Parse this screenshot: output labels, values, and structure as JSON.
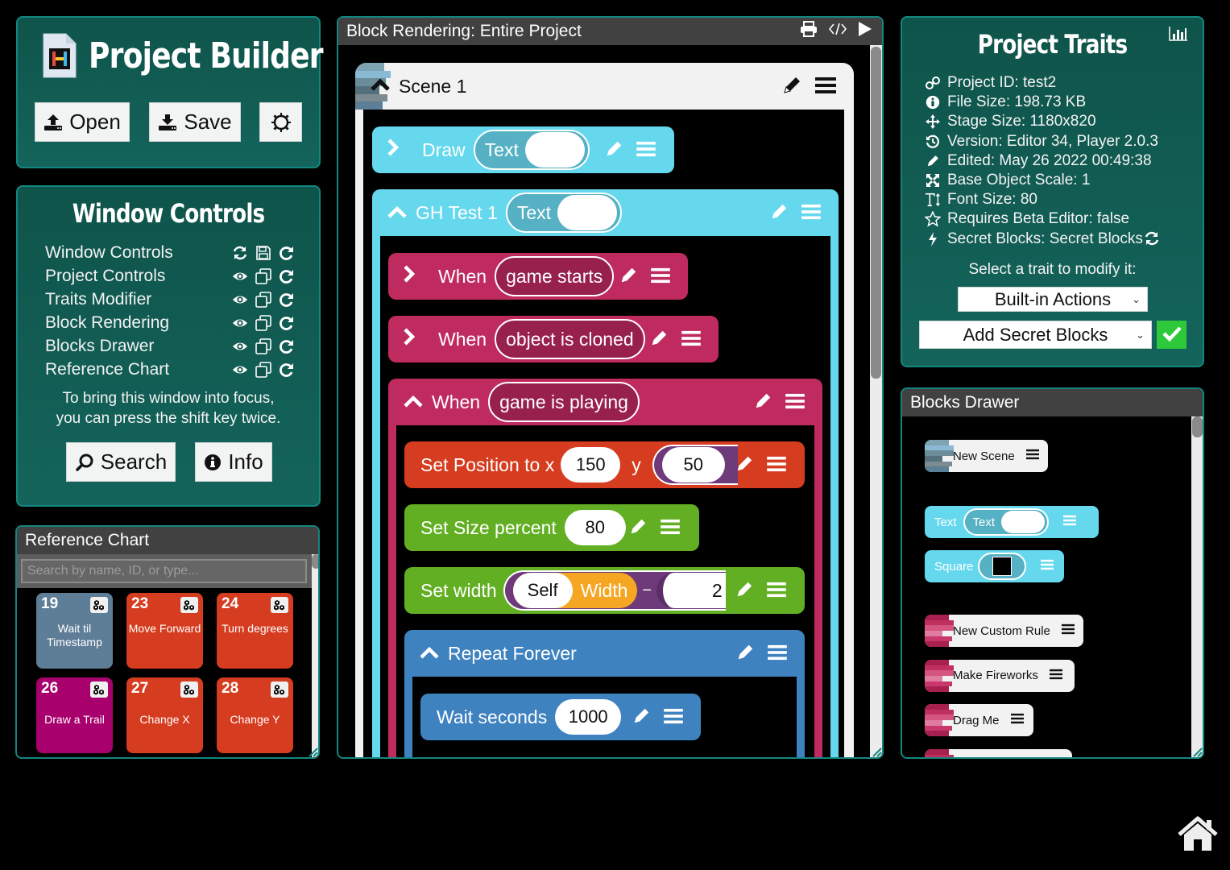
{
  "project_builder": {
    "title": "Project Builder",
    "logo_icon": "hopscotch-file-icon",
    "open_label": "Open",
    "save_label": "Save",
    "settings_icon": "gear-icon"
  },
  "window_controls": {
    "title": "Window Controls",
    "rows": [
      {
        "label": "Window Controls",
        "icons": [
          "refresh-icon",
          "floppy-save-icon",
          "redo-icon"
        ]
      },
      {
        "label": "Project Controls",
        "icons": [
          "eye-icon",
          "copy-icon",
          "redo-icon"
        ]
      },
      {
        "label": "Traits Modifier",
        "icons": [
          "eye-icon",
          "copy-icon",
          "redo-icon"
        ]
      },
      {
        "label": "Block Rendering",
        "icons": [
          "eye-icon",
          "copy-icon",
          "redo-icon"
        ]
      },
      {
        "label": "Blocks Drawer",
        "icons": [
          "eye-icon",
          "copy-icon",
          "redo-icon"
        ]
      },
      {
        "label": "Reference Chart",
        "icons": [
          "eye-icon",
          "copy-icon",
          "redo-icon"
        ]
      }
    ],
    "hint_line1": "To bring this window into focus,",
    "hint_line2": "you can press the shift key twice.",
    "search_label": "Search",
    "info_label": "Info"
  },
  "reference_chart": {
    "title": "Reference Chart",
    "search_placeholder": "Search by name, ID, or type...",
    "cards": [
      {
        "id": "19",
        "name": "Wait til Timestamp",
        "color": "#5e7d97"
      },
      {
        "id": "23",
        "name": "Move Forward",
        "color": "#d63c1f"
      },
      {
        "id": "24",
        "name": "Turn degrees",
        "color": "#d63c1f"
      },
      {
        "id": "26",
        "name": "Draw a Trail",
        "color": "#a8006c"
      },
      {
        "id": "27",
        "name": "Change X",
        "color": "#d63c1f"
      },
      {
        "id": "28",
        "name": "Change Y",
        "color": "#d63c1f"
      }
    ]
  },
  "block_rendering": {
    "title": "Block Rendering: Entire Project",
    "header_icons": [
      "print-icon",
      "code-icon",
      "play-icon"
    ],
    "scene": {
      "label": "Scene 1"
    },
    "draw_block": {
      "label": "Draw",
      "param": "Text"
    },
    "object_block": {
      "label": "GH Test 1",
      "param": "Text"
    },
    "rules": [
      {
        "when": "When",
        "event": "game starts"
      },
      {
        "when": "When",
        "event": "object is cloned"
      },
      {
        "when": "When",
        "event": "game is playing"
      }
    ],
    "set_position": {
      "label": "Set Position to x",
      "x": "150",
      "y_label": "y",
      "y": "50"
    },
    "set_size": {
      "label": "Set Size percent",
      "value": "80"
    },
    "set_width": {
      "label": "Set width",
      "obj": "Self",
      "trait": "Width",
      "op": "−",
      "value": "2"
    },
    "repeat": {
      "label": "Repeat Forever"
    },
    "wait": {
      "label": "Wait seconds",
      "value": "1000"
    }
  },
  "project_traits": {
    "title": "Project Traits",
    "stats_icon": "bar-chart-icon",
    "traits": [
      {
        "icon": "link-icon",
        "text": "Project ID: test2"
      },
      {
        "icon": "info-icon",
        "text": "File Size: 198.73 KB"
      },
      {
        "icon": "move-arrows-icon",
        "text": "Stage Size: 1180x820"
      },
      {
        "icon": "history-icon",
        "text": "Version: Editor 34, Player 2.0.3"
      },
      {
        "icon": "pencil-icon",
        "text": "Edited: May 26 2022 00:49:38"
      },
      {
        "icon": "expand-icon",
        "text": "Base Object Scale: 1"
      },
      {
        "icon": "text-height-icon",
        "text": "Font Size: 80"
      },
      {
        "icon": "star-icon",
        "text": "Requires Beta Editor: false"
      },
      {
        "icon": "bolt-icon",
        "text": "Secret Blocks: Secret Blocks"
      }
    ],
    "select_prompt": "Select a trait to modify it:",
    "category_select": "Built-in Actions",
    "action_select": "Add Secret Blocks",
    "confirm_color": "#2ec93a"
  },
  "blocks_drawer": {
    "title": "Blocks Drawer",
    "items": [
      {
        "label": "New Scene"
      },
      {
        "label": "Text",
        "param": "Text"
      },
      {
        "label": "Square"
      },
      {
        "label": "New Custom Rule"
      },
      {
        "label": "Make Fireworks"
      },
      {
        "label": "Drag Me"
      }
    ]
  },
  "colors": {
    "panel_bg": "#0f544a",
    "panel_border": "#13877f",
    "object_cyan": "#66d8ee",
    "rule_pink": "#bf2a5f",
    "rule_pill": "#98204c",
    "move_red": "#d63c1f",
    "looks_green": "#63af24",
    "control_blue": "#3f82c0",
    "operator_purple": "#6e3a7a",
    "trait_orange": "#f5a623"
  }
}
